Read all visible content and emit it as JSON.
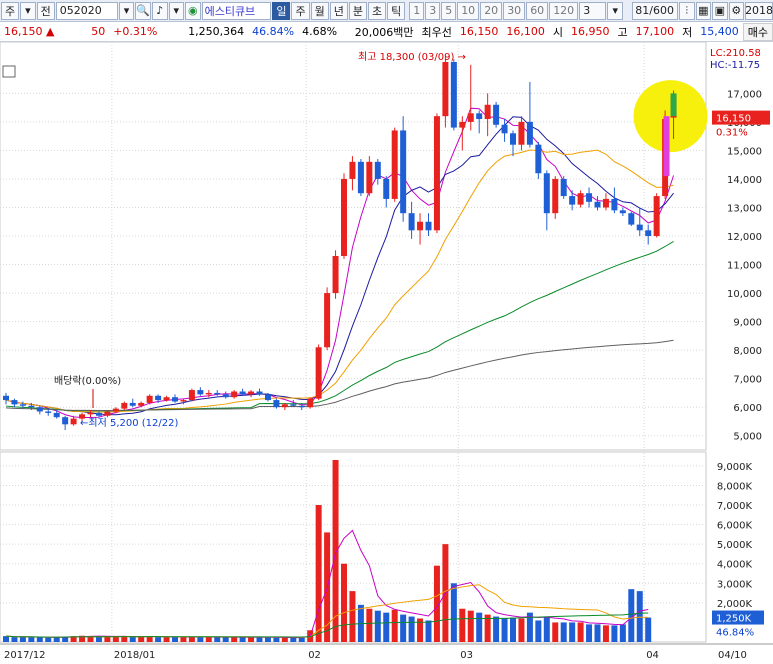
{
  "toolbar": {
    "type_label": "주",
    "market_label": "전",
    "code": "052020",
    "stock_name": "에스티큐브",
    "periods": [
      "일",
      "주",
      "월",
      "년",
      "분",
      "초",
      "틱"
    ],
    "selected_period": "일",
    "intervals": [
      "1",
      "3",
      "5",
      "10",
      "20",
      "30",
      "60",
      "120"
    ],
    "interval_value": "3",
    "page_counter": "81/600",
    "date_field": "2018"
  },
  "infobar": {
    "price": "16,150",
    "change": "50",
    "change_pct": "+0.31%",
    "volume": "1,250,364",
    "volume_pct": "46.84%",
    "turnover_pct": "4.68%",
    "amount": "20,006백만",
    "best_bid_label": "최우선",
    "best_bid_1": "16,150",
    "best_bid_2": "16,100",
    "open_label": "시",
    "open": "16,950",
    "high_label": "고",
    "high": "17,100",
    "low_label": "저",
    "low": "15,400",
    "trade_label": "매수"
  },
  "colors": {
    "up": "#e8231f",
    "down": "#1f5fd6",
    "ma5": "#c800c8",
    "ma10": "#1a1aa0",
    "ma20": "#f0a000",
    "ma60": "#0a8a2a",
    "ma120": "#606060",
    "highlight": "#f7ef00"
  },
  "annotations": {
    "high": "최고 18,300 (03/09)",
    "low": "최저 5,200 (12/22)",
    "dividend": "배당락(0.00%)",
    "lc": "LC:210.58",
    "hc": "HC:-11.75",
    "current_price": "16,150",
    "current_pct": "0.31%",
    "current_volume": "1,250K",
    "current_volume_pct": "46.84%"
  },
  "chart_data": {
    "type": "candlestick",
    "price_axis": {
      "min": 4500,
      "max": 18800,
      "ticks": [
        "17,000",
        "16,000",
        "15,000",
        "14,000",
        "13,000",
        "12,000",
        "11,000",
        "10,000",
        "9,000",
        "8,000",
        "7,000",
        "6,000",
        "5,000"
      ]
    },
    "volume_axis": {
      "min": 0,
      "max": 9300,
      "unit": "K",
      "ticks": [
        "9,000K",
        "8,000K",
        "7,000K",
        "6,000K",
        "5,000K",
        "4,000K",
        "3,000K",
        "2,000K"
      ]
    },
    "x_labels": [
      "2017/12",
      "2018/01",
      "02",
      "03",
      "04",
      "04/10"
    ],
    "x_label_index": [
      0,
      13,
      36,
      54,
      76,
      92
    ],
    "candles": [
      [
        6400,
        6500,
        6100,
        6250
      ],
      [
        6250,
        6300,
        6000,
        6100
      ],
      [
        6100,
        6200,
        5950,
        6050
      ],
      [
        6050,
        6150,
        5900,
        6000
      ],
      [
        6000,
        6050,
        5750,
        5850
      ],
      [
        5850,
        5950,
        5700,
        5800
      ],
      [
        5800,
        5900,
        5600,
        5650
      ],
      [
        5650,
        5700,
        5200,
        5400
      ],
      [
        5400,
        5700,
        5350,
        5600
      ],
      [
        5600,
        5800,
        5500,
        5750
      ],
      [
        5750,
        5900,
        5650,
        5800
      ],
      [
        5800,
        5850,
        5650,
        5700
      ],
      [
        5700,
        5900,
        5650,
        5850
      ],
      [
        5850,
        6000,
        5800,
        5950
      ],
      [
        5950,
        6200,
        5900,
        6150
      ],
      [
        6150,
        6300,
        6000,
        6050
      ],
      [
        6050,
        6200,
        6000,
        6150
      ],
      [
        6150,
        6450,
        6100,
        6400
      ],
      [
        6400,
        6450,
        6150,
        6250
      ],
      [
        6250,
        6400,
        6200,
        6350
      ],
      [
        6350,
        6450,
        6150,
        6200
      ],
      [
        6200,
        6300,
        6100,
        6250
      ],
      [
        6250,
        6650,
        6200,
        6600
      ],
      [
        6600,
        6700,
        6400,
        6450
      ],
      [
        6450,
        6600,
        6350,
        6500
      ],
      [
        6500,
        6600,
        6400,
        6450
      ],
      [
        6450,
        6550,
        6300,
        6350
      ],
      [
        6350,
        6600,
        6300,
        6550
      ],
      [
        6550,
        6650,
        6400,
        6450
      ],
      [
        6450,
        6600,
        6350,
        6550
      ],
      [
        6550,
        6650,
        6400,
        6450
      ],
      [
        6450,
        6500,
        6200,
        6250
      ],
      [
        6250,
        6300,
        5950,
        6000
      ],
      [
        6000,
        6150,
        5900,
        6100
      ],
      [
        6100,
        6250,
        6000,
        6050
      ],
      [
        6050,
        6150,
        5900,
        6000
      ],
      [
        6000,
        6350,
        5950,
        6300
      ],
      [
        6300,
        8200,
        6250,
        8100
      ],
      [
        8100,
        10200,
        8000,
        10000
      ],
      [
        10000,
        11500,
        9800,
        11300
      ],
      [
        11300,
        14200,
        11200,
        14000
      ],
      [
        14000,
        14800,
        13600,
        14600
      ],
      [
        14600,
        14700,
        13400,
        13500
      ],
      [
        13500,
        14800,
        13400,
        14600
      ],
      [
        14600,
        14700,
        13800,
        14000
      ],
      [
        14000,
        14100,
        13000,
        13300
      ],
      [
        13300,
        15800,
        13200,
        15700
      ],
      [
        15700,
        16200,
        12500,
        12800
      ],
      [
        12800,
        13200,
        11900,
        12200
      ],
      [
        12200,
        12800,
        11700,
        12500
      ],
      [
        12500,
        12800,
        12000,
        12200
      ],
      [
        12200,
        16300,
        12100,
        16200
      ],
      [
        16200,
        18300,
        15800,
        18100
      ],
      [
        18100,
        18200,
        15700,
        15800
      ],
      [
        15800,
        16200,
        15000,
        16000
      ],
      [
        16000,
        18000,
        15700,
        16300
      ],
      [
        16300,
        16400,
        15600,
        16100
      ],
      [
        16100,
        17000,
        15500,
        16600
      ],
      [
        16600,
        16700,
        15800,
        15900
      ],
      [
        15900,
        16100,
        15300,
        15600
      ],
      [
        15600,
        15700,
        14800,
        15200
      ],
      [
        15200,
        16200,
        15000,
        16000
      ],
      [
        16000,
        17400,
        15100,
        15200
      ],
      [
        15200,
        15300,
        14000,
        14200
      ],
      [
        14200,
        14300,
        12200,
        12800
      ],
      [
        12800,
        14100,
        12600,
        14000
      ],
      [
        14000,
        14100,
        13300,
        13400
      ],
      [
        13400,
        13600,
        12900,
        13100
      ],
      [
        13100,
        13600,
        13000,
        13500
      ],
      [
        13500,
        13700,
        13000,
        13200
      ],
      [
        13200,
        13400,
        12900,
        13000
      ],
      [
        13000,
        13500,
        12900,
        13300
      ],
      [
        13300,
        13700,
        12800,
        12900
      ],
      [
        12900,
        13000,
        12700,
        12800
      ],
      [
        12800,
        12850,
        12350,
        12400
      ],
      [
        12400,
        13000,
        12000,
        12200
      ],
      [
        12200,
        12400,
        11700,
        12000
      ],
      [
        12000,
        13500,
        11950,
        13400
      ],
      [
        13400,
        16400,
        13300,
        16100
      ],
      [
        16150,
        17100,
        15400,
        16900
      ]
    ],
    "volumes": [
      300,
      250,
      260,
      230,
      240,
      220,
      250,
      280,
      300,
      320,
      290,
      300,
      260,
      270,
      310,
      260,
      270,
      300,
      250,
      240,
      260,
      230,
      280,
      260,
      250,
      240,
      230,
      260,
      240,
      250,
      230,
      240,
      220,
      230,
      210,
      220,
      600,
      7000,
      5600,
      9300,
      4000,
      2600,
      1900,
      1700,
      1600,
      1500,
      1650,
      1400,
      1300,
      1200,
      1100,
      3900,
      5000,
      3000,
      1700,
      1600,
      1500,
      1400,
      1300,
      1200,
      1250,
      1200,
      1500,
      1100,
      1300,
      1000,
      1000,
      1000,
      1000,
      900,
      900,
      850,
      850,
      900,
      2700,
      2600,
      1250
    ]
  }
}
